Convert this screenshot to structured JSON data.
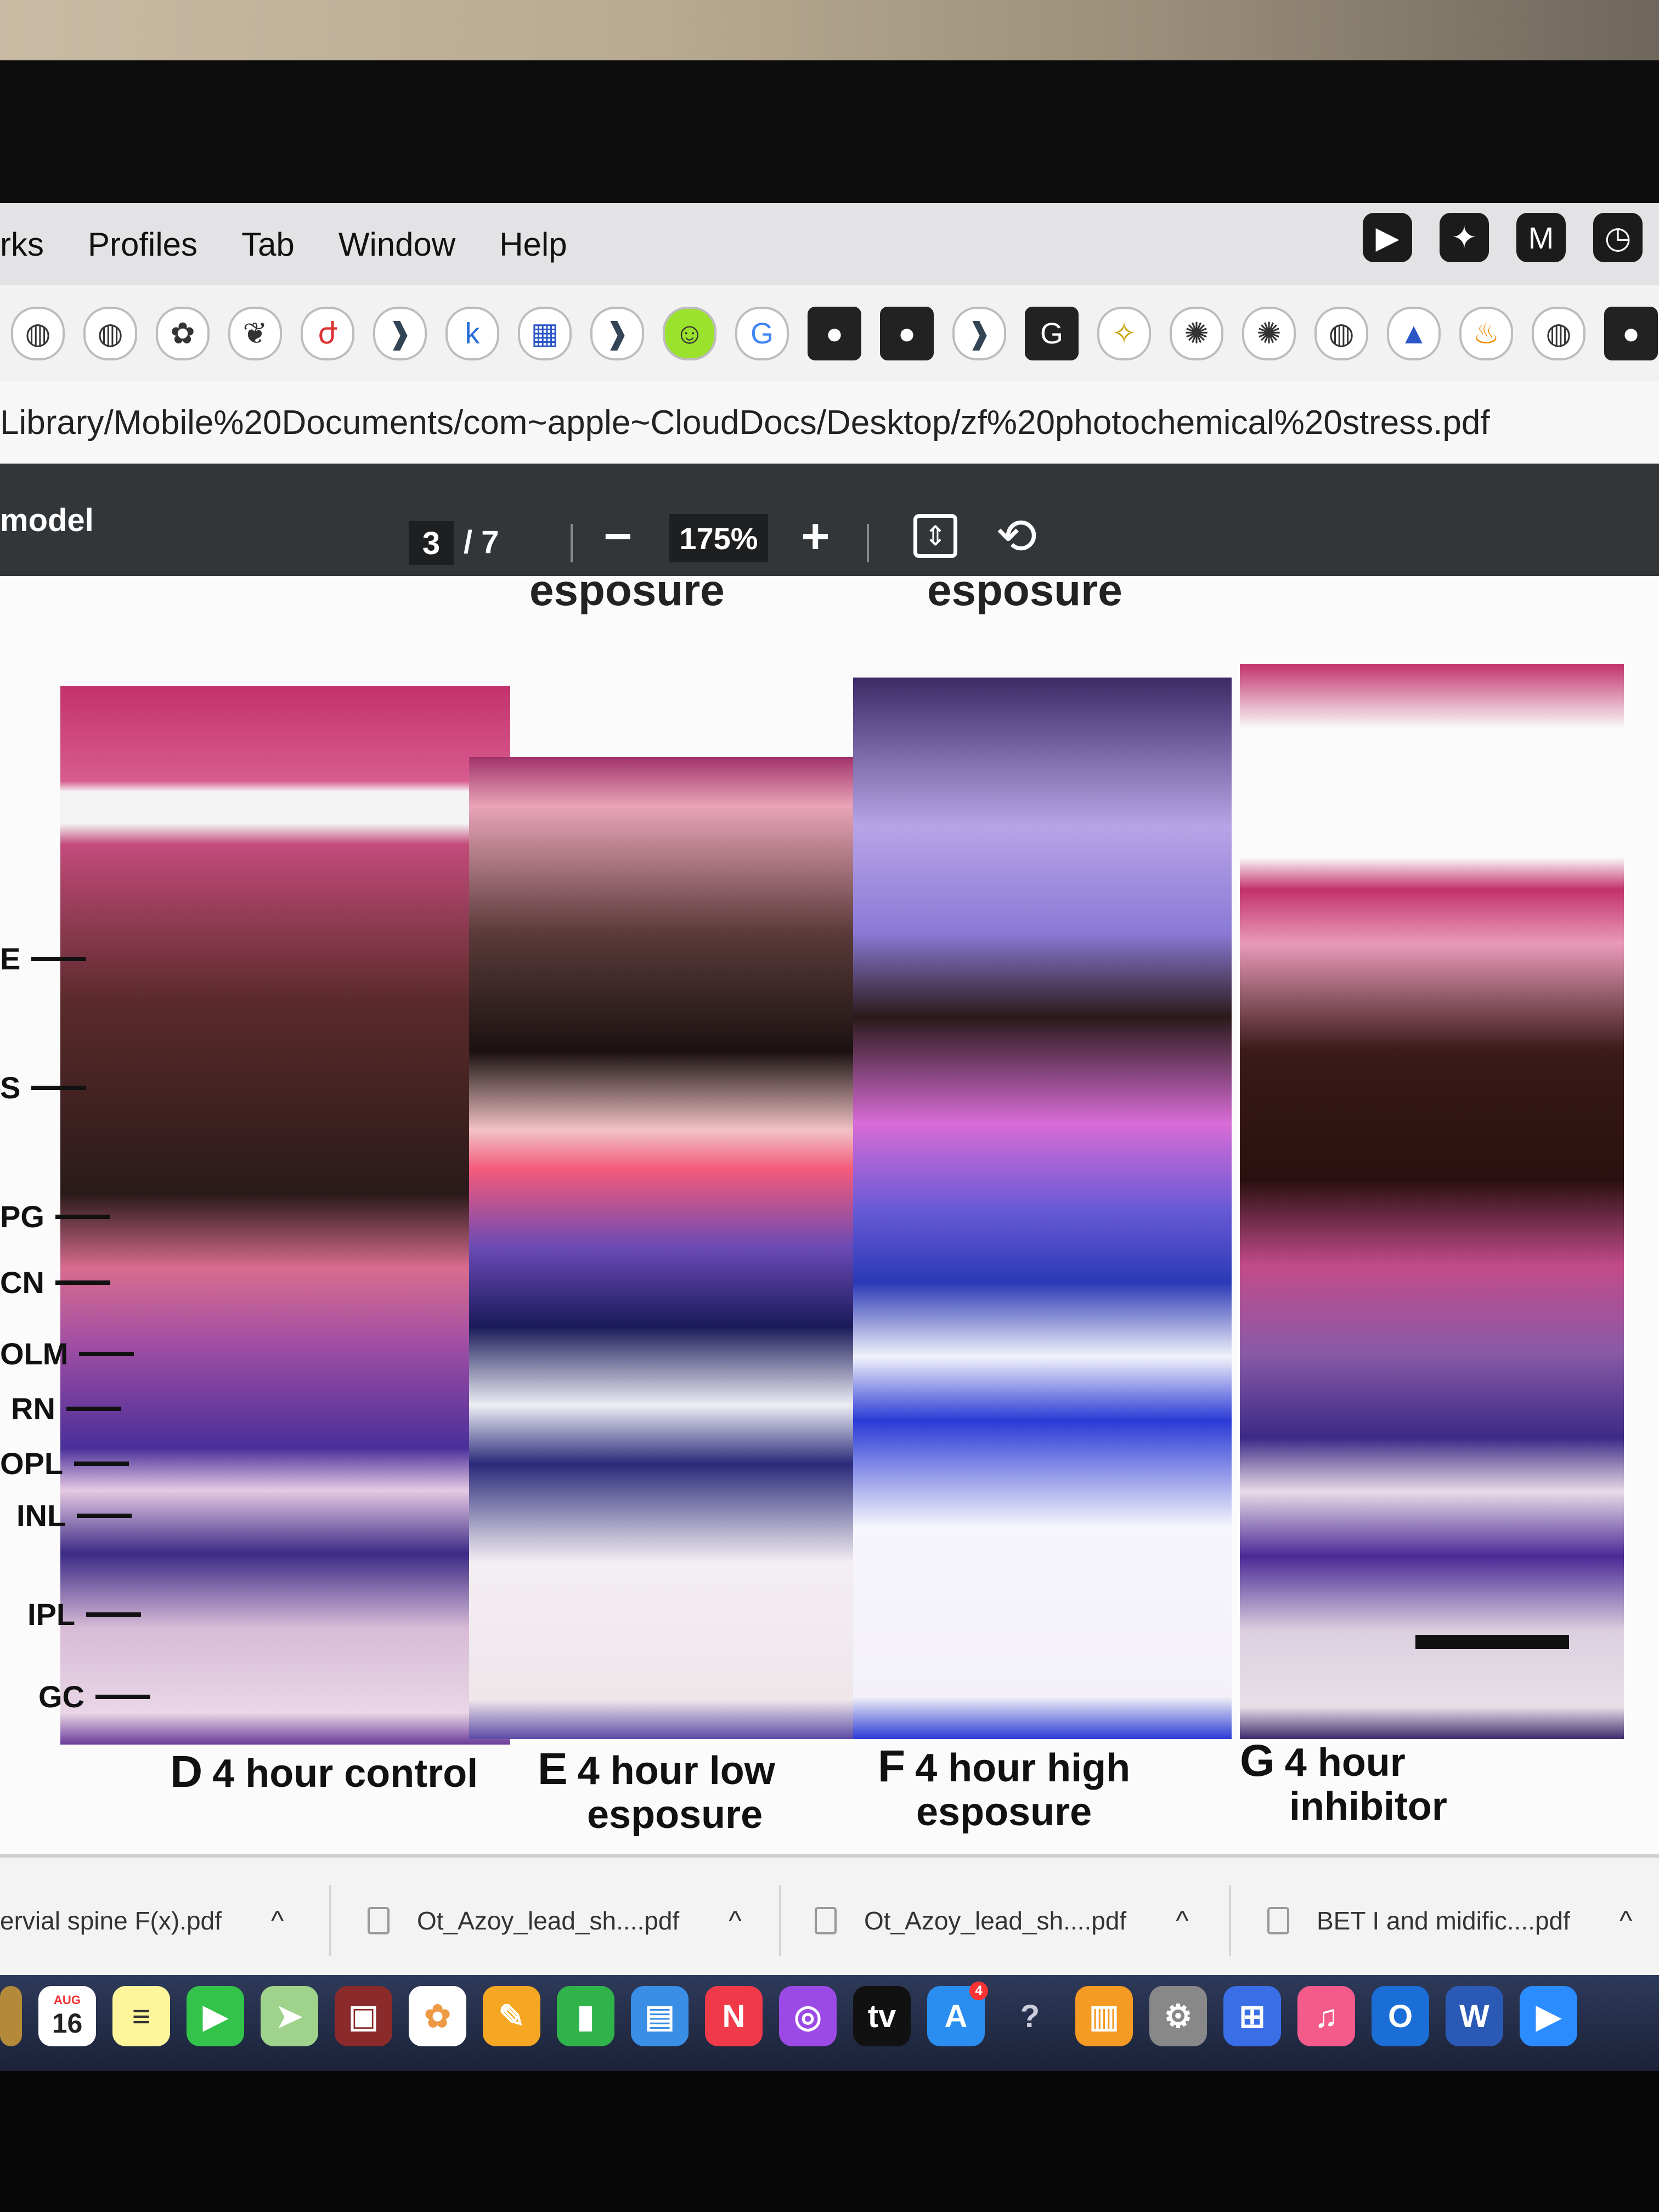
{
  "menubar": {
    "items": [
      "rks",
      "Profiles",
      "Tab",
      "Window",
      "Help"
    ],
    "status_icons": [
      "video-icon",
      "feather-icon",
      "m-logo-icon",
      "clock-history-icon"
    ]
  },
  "bookmarks": {
    "icons": [
      "globe-icon",
      "globe-icon",
      "puzzle-icon",
      "fruit-icon",
      "red-app-icon",
      "arrow-chevron-icon",
      "k-letter-icon",
      "grid-globe-icon",
      "arrow-chevron-icon",
      "smiley-icon",
      "google-icon",
      "github-icon",
      "github-icon",
      "arrow-chevron-icon",
      "g-box-icon",
      "bird-icon",
      "starburst-icon",
      "starburst-icon",
      "globe-icon",
      "mountain-icon",
      "flame-icon",
      "globe-icon",
      "github-icon"
    ],
    "k_label": "k",
    "google_label": "G",
    "g_label": "G"
  },
  "url": {
    "text": "Library/Mobile%20Documents/com~apple~CloudDocs/Desktop/zf%20photochemical%20stress.pdf"
  },
  "pdf_toolbar": {
    "title": "model",
    "page_current": "3",
    "page_total": "/ 7",
    "zoom": "175%",
    "minus": "−",
    "plus": "+"
  },
  "figure": {
    "cut_headings": [
      "esposure",
      "esposure"
    ],
    "layer_labels": [
      "E",
      "S",
      "PG",
      "CN",
      "OLM",
      "RN",
      "OPL",
      "INL",
      "IPL",
      "GC"
    ],
    "captions": [
      {
        "letter": "D",
        "line1": "4 hour control",
        "line2": ""
      },
      {
        "letter": "E",
        "line1": "4 hour low",
        "line2": "esposure"
      },
      {
        "letter": "F",
        "line1": "4 hour high",
        "line2": "esposure"
      },
      {
        "letter": "G",
        "line1": "4 hour",
        "line2": "inhibitor"
      }
    ]
  },
  "downloads": {
    "items": [
      {
        "name": "ervial spine F(x).pdf"
      },
      {
        "name": "Ot_Azoy_lead_sh....pdf"
      },
      {
        "name": "Ot_Azoy_lead_sh....pdf"
      },
      {
        "name": "BET I and midific....pdf"
      }
    ],
    "chevron": "^"
  },
  "dock": {
    "calendar_month": "AUG",
    "calendar_day": "16",
    "tv_label": "tv",
    "appstore_badge": "4",
    "help_label": "?",
    "icons": [
      "finder-icon",
      "calendar-icon",
      "notes-icon",
      "facetime-icon",
      "maps-icon",
      "photobooth-icon",
      "photos-icon",
      "pages-icon",
      "numbers-icon",
      "keynote-icon",
      "news-icon",
      "podcasts-icon",
      "appletv-icon",
      "appstore-icon",
      "help-icon",
      "books-icon",
      "settings-icon",
      "photo-edit-icon",
      "music-icon",
      "outlook-icon",
      "word-icon",
      "zoom-icon"
    ]
  },
  "colors": {
    "menubar_bg": "#e3e3e5",
    "pdf_toolbar_bg": "#323639",
    "downloads_bg": "#f3f3f3",
    "dock_bg": "#1b2238"
  }
}
